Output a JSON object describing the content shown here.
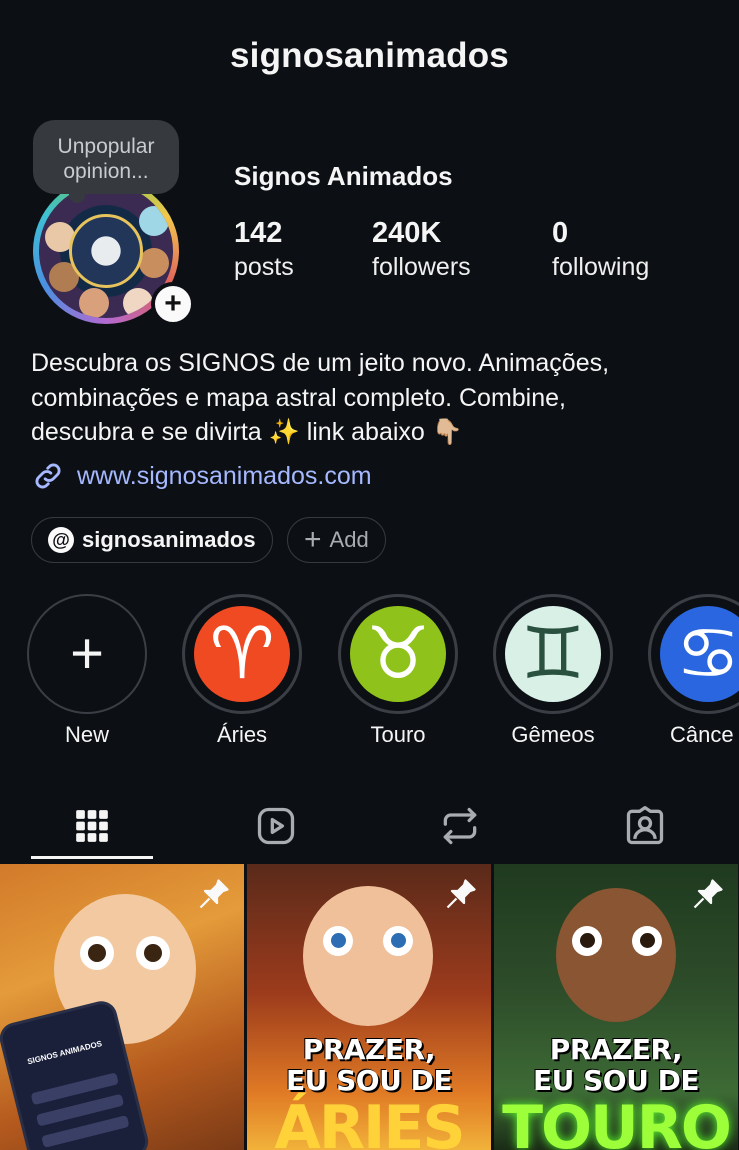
{
  "header": {
    "username": "signosanimados"
  },
  "note": {
    "text": "Unpopular opinion..."
  },
  "profile": {
    "display_name": "Signos Animados",
    "stats": [
      {
        "value": "142",
        "label": "posts"
      },
      {
        "value": "240K",
        "label": "followers"
      },
      {
        "value": "0",
        "label": "following"
      }
    ],
    "bio_lines": [
      "Descubra os SIGNOS de um jeito novo. Animações,",
      "combinações e mapa astral completo. Combine,",
      "descubra e se divirta ✨ link abaixo 👇🏼"
    ],
    "link": "www.signosanimados.com",
    "threads_handle": "signosanimados",
    "add_label": "Add"
  },
  "highlights": [
    {
      "label": "New",
      "symbol": "+",
      "color": ""
    },
    {
      "label": "Áries",
      "symbol": "♈",
      "color": "#f04a23"
    },
    {
      "label": "Touro",
      "symbol": "♉",
      "color": "#8fc21a"
    },
    {
      "label": "Gêmeos",
      "symbol": "♊",
      "color": "#d8f0e6"
    },
    {
      "label": "Cânce",
      "symbol": "♋",
      "color": "#2a66e0"
    }
  ],
  "tabs": [
    {
      "name": "posts-grid",
      "icon": "grid-icon",
      "active": true
    },
    {
      "name": "reels",
      "icon": "reels-icon",
      "active": false
    },
    {
      "name": "reposts",
      "icon": "repost-icon",
      "active": false
    },
    {
      "name": "tagged",
      "icon": "tagged-icon",
      "active": false
    }
  ],
  "posts": [
    {
      "icon": "pin-icon",
      "phone_title": "SIGNOS ANIMADOS"
    },
    {
      "icon": "pin-icon",
      "title_line1": "PRAZER,",
      "title_line2": "EU SOU DE",
      "sign": "ÁRIES"
    },
    {
      "icon": "pin-icon",
      "title_line1": "PRAZER,",
      "title_line2": "EU SOU DE",
      "sign": "TOURO"
    }
  ],
  "colors": {
    "background": "#0c1014",
    "link": "#a6b8ff",
    "chip_border": "#363a3f",
    "aries_sign": "#ffd23a",
    "touro_sign": "#9cff3a"
  }
}
